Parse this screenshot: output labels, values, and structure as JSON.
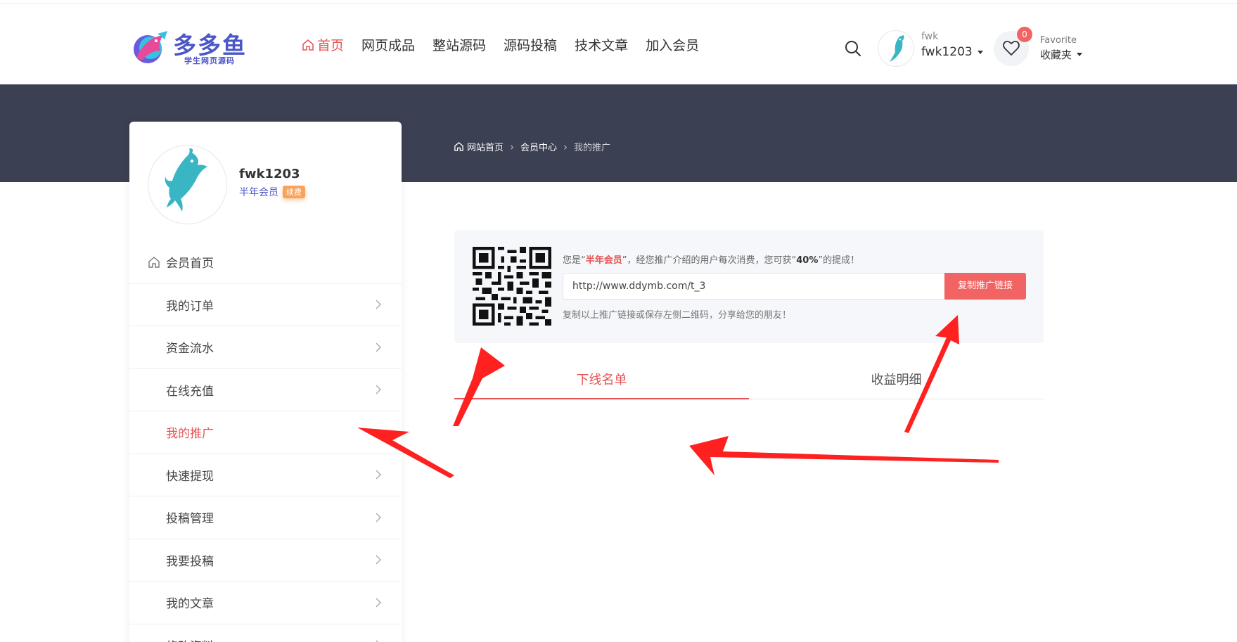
{
  "brand": {
    "name": "多多鱼",
    "subtitle": "学生网页源码"
  },
  "nav": {
    "items": [
      {
        "label": "首页",
        "active": true
      },
      {
        "label": "网页成品"
      },
      {
        "label": "整站源码"
      },
      {
        "label": "源码投稿"
      },
      {
        "label": "技术文章"
      },
      {
        "label": "加入会员"
      }
    ]
  },
  "user_menu": {
    "small_label": "fwk",
    "name": "fwk1203"
  },
  "favorites": {
    "count": "0",
    "small_label": "Favorite",
    "label": "收藏夹"
  },
  "breadcrumb": {
    "home": "网站首页",
    "level2": "会员中心",
    "current": "我的推广"
  },
  "profile": {
    "username": "fwk1203",
    "level": "半年会员",
    "renew": "续费"
  },
  "sidebar": {
    "items": [
      {
        "label": "会员首页"
      },
      {
        "label": "我的订单"
      },
      {
        "label": "资金流水"
      },
      {
        "label": "在线充值"
      },
      {
        "label": "我的推广",
        "active": true
      },
      {
        "label": "快速提现"
      },
      {
        "label": "投稿管理"
      },
      {
        "label": "我要投稿"
      },
      {
        "label": "我的文章"
      },
      {
        "label": "修改资料"
      }
    ]
  },
  "promo": {
    "text_prefix": "您是“",
    "level": "半年会员",
    "text_mid": "”，经您推广介绍的用户每次消费，您可获“",
    "rate": "40%",
    "text_suffix": "”的提成！",
    "link_value": "http://www.ddymb.com/t_3",
    "copy_button": "复制推广链接",
    "hint": "复制以上推广链接或保存左侧二维码，分享给您的朋友！"
  },
  "tabs": [
    {
      "label": "下线名单",
      "active": true
    },
    {
      "label": "收益明细"
    }
  ],
  "colors": {
    "accent": "#e55353",
    "banner": "#3b4052",
    "brand": "#4a56c9",
    "arrow": "#ff2020"
  }
}
